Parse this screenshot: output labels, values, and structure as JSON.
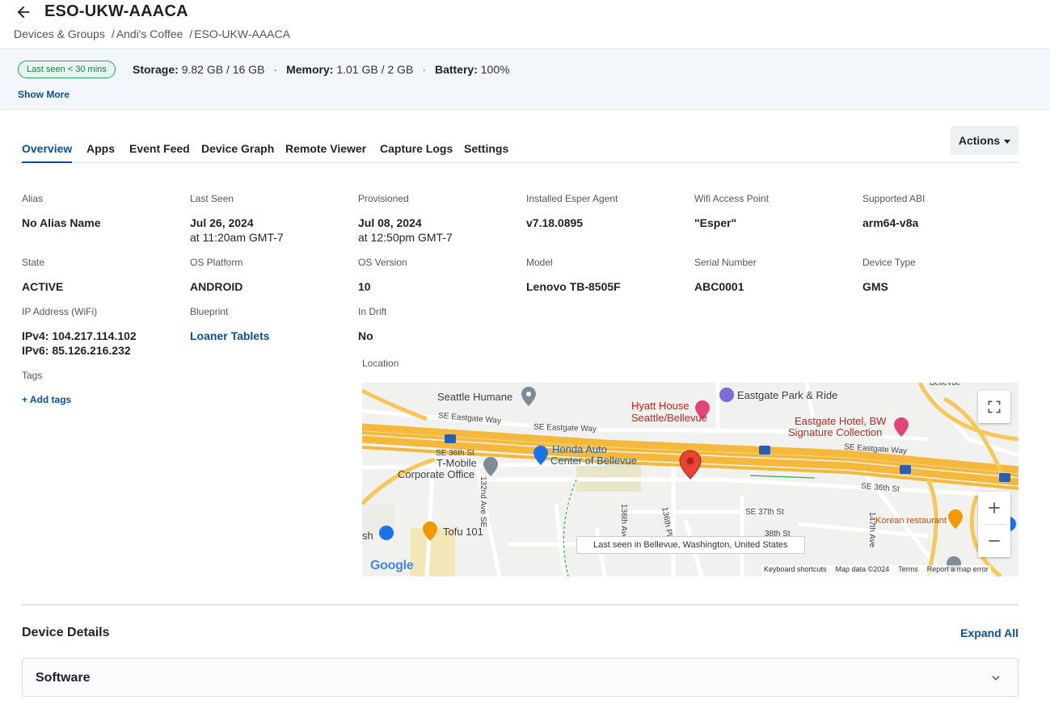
{
  "header": {
    "title": "ESO-UKW-AAACA",
    "breadcrumb": [
      {
        "label": "Devices & Groups"
      },
      {
        "label": "Andi's Coffee"
      },
      {
        "label": "ESO-UKW-AAACA"
      }
    ],
    "breadcrumb_sep": "/"
  },
  "status": {
    "badge": "Last seen < 30 mins",
    "storage_label": "Storage:",
    "storage_value": "9.82 GB / 16 GB",
    "memory_label": "Memory:",
    "memory_value": "1.01 GB / 2 GB",
    "battery_label": "Battery:",
    "battery_value": "100%",
    "dot": "·",
    "show_more": "Show More"
  },
  "tabs": [
    {
      "label": "Overview",
      "active": true
    },
    {
      "label": "Apps"
    },
    {
      "label": "Event Feed"
    },
    {
      "label": "Device Graph"
    },
    {
      "label": "Remote Viewer"
    },
    {
      "label": "Capture Logs"
    },
    {
      "label": "Settings"
    }
  ],
  "actions_label": "Actions",
  "fields": {
    "alias": {
      "label": "Alias",
      "value": "No Alias Name"
    },
    "last_seen": {
      "label": "Last Seen",
      "value": "Jul 26, 2024",
      "sub": "at 11:20am GMT-7"
    },
    "provisioned": {
      "label": "Provisioned",
      "value": "Jul 08, 2024",
      "sub": "at 12:50pm GMT-7"
    },
    "agent": {
      "label": "Installed Esper Agent",
      "value": "v7.18.0895"
    },
    "wifi": {
      "label": "Wifi Access Point",
      "value": "\"Esper\""
    },
    "abi": {
      "label": "Supported ABI",
      "value": "arm64-v8a"
    },
    "state": {
      "label": "State",
      "value": "ACTIVE"
    },
    "os_platform": {
      "label": "OS Platform",
      "value": "ANDROID"
    },
    "os_version": {
      "label": "OS Version",
      "value": "10"
    },
    "model": {
      "label": "Model",
      "value": "Lenovo TB-8505F"
    },
    "serial": {
      "label": "Serial Number",
      "value": "ABC0001"
    },
    "device_type": {
      "label": "Device Type",
      "value": "GMS"
    },
    "ip": {
      "label": "IP Address (WiFi)",
      "ipv4": "IPv4: 104.217.114.102",
      "ipv6": "IPv6: 85.126.216.232"
    },
    "blueprint": {
      "label": "Blueprint",
      "value": "Loaner Tablets"
    },
    "in_drift": {
      "label": "In Drift",
      "value": "No"
    },
    "tags": {
      "label": "Tags",
      "add": "+ Add tags"
    }
  },
  "location": {
    "label": "Location",
    "tooltip": "Last seen in Bellevue, Washington, United States",
    "attribution": [
      "Keyboard shortcuts",
      "Map data ©2024",
      "Terms",
      "Report a map error"
    ],
    "places": {
      "seattle_humane": "Seattle Humane",
      "hyatt_1": "Hyatt House",
      "hyatt_2": "Seattle/Bellevue",
      "eastgate_park": "Eastgate Park & Ride",
      "eastgate_hotel_1": "Eastgate Hotel, BW",
      "eastgate_hotel_2": "Signature Collection",
      "honda_1": "Honda Auto",
      "honda_2": "Center of Bellevue",
      "tmobile_1": "T-Mobile",
      "tmobile_2": "Corporate Office",
      "tofu": "Tofu 101",
      "korean": "Korean restaurant",
      "bellevue_top": "Bellevue",
      "sh": "sh"
    },
    "streets": {
      "eastgate_way_1": "SE Eastgate Way",
      "eastgate_way_2": "SE Eastgate Way",
      "eastgate_way_3": "SE Eastgate Way",
      "se36_1": "SE 36th St",
      "se36_2": "SE 36th St",
      "se37": "SE 37th St",
      "ave132": "132nd Ave SE",
      "ave136": "136th Ave",
      "pl136": "136th Pl SE",
      "st38": "38th St",
      "ave147": "147th Ave",
      "hwy": "90"
    },
    "google": "Google"
  },
  "device_details": {
    "title": "Device Details",
    "expand_all": "Expand All",
    "software": "Software"
  }
}
